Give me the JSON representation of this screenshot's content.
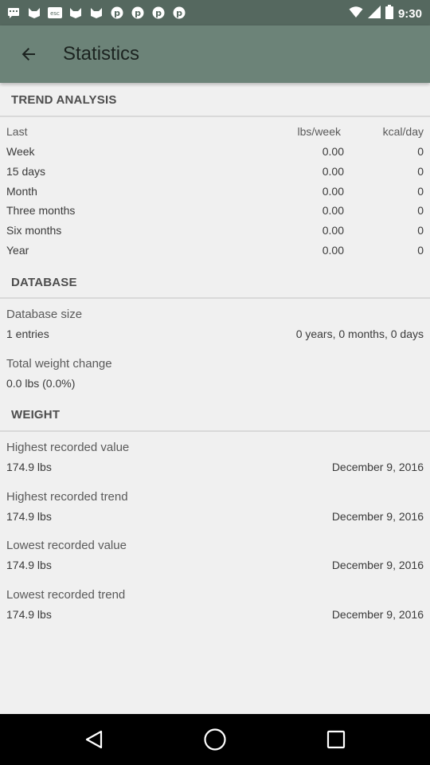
{
  "status_bar": {
    "time": "9:30",
    "left_icons": [
      "sms-icon",
      "cat-icon",
      "esc-icon",
      "cat-icon",
      "cat-icon",
      "pinterest-icon",
      "pinterest-icon",
      "pinterest-icon",
      "pinterest-icon"
    ]
  },
  "app_bar": {
    "title": "Statistics"
  },
  "trend": {
    "header": "TREND ANALYSIS",
    "columns": [
      "Last",
      "lbs/week",
      "kcal/day"
    ],
    "rows": [
      {
        "label": "Week",
        "lbs": "0.00",
        "kcal": "0"
      },
      {
        "label": "15 days",
        "lbs": "0.00",
        "kcal": "0"
      },
      {
        "label": "Month",
        "lbs": "0.00",
        "kcal": "0"
      },
      {
        "label": "Three months",
        "lbs": "0.00",
        "kcal": "0"
      },
      {
        "label": "Six months",
        "lbs": "0.00",
        "kcal": "0"
      },
      {
        "label": "Year",
        "lbs": "0.00",
        "kcal": "0"
      }
    ]
  },
  "database": {
    "header": "DATABASE",
    "size_label": "Database size",
    "entries": "1 entries",
    "duration": "0 years, 0 months, 0 days",
    "weight_change_label": "Total weight change",
    "weight_change_value": "0.0 lbs (0.0%)"
  },
  "weight": {
    "header": "WEIGHT",
    "items": [
      {
        "label": "Highest recorded value",
        "value": "174.9 lbs",
        "date": "December 9, 2016"
      },
      {
        "label": "Highest recorded trend",
        "value": "174.9 lbs",
        "date": "December 9, 2016"
      },
      {
        "label": "Lowest recorded value",
        "value": "174.9 lbs",
        "date": "December 9, 2016"
      },
      {
        "label": "Lowest recorded trend",
        "value": "174.9 lbs",
        "date": "December 9, 2016"
      }
    ]
  },
  "colors": {
    "status_bar": "#55685f",
    "app_bar": "#6c8378",
    "background": "#f0f0f0"
  }
}
